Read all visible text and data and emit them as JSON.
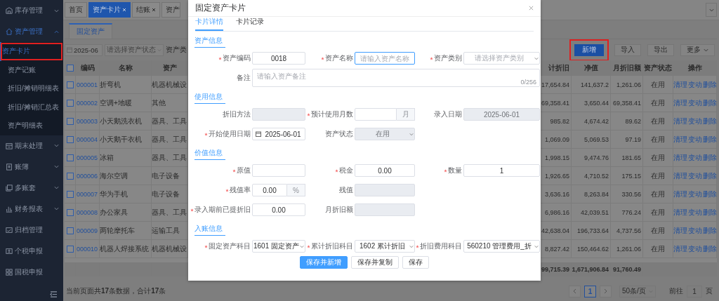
{
  "sidebar": {
    "items": [
      {
        "label": "库存管理",
        "kind": "group",
        "expanded": false,
        "active": false
      },
      {
        "label": "资产管理",
        "kind": "group",
        "expanded": true,
        "active": true,
        "children": [
          {
            "label": "资产卡片",
            "selected": true,
            "annotated": true
          },
          {
            "label": "资产记账",
            "selected": false,
            "annotated": false
          },
          {
            "label": "折旧/摊销明细表",
            "selected": false,
            "annotated": false
          },
          {
            "label": "折旧/摊销汇总表",
            "selected": false,
            "annotated": false
          },
          {
            "label": "资产明细表",
            "selected": false,
            "annotated": false
          }
        ]
      },
      {
        "label": "期末处理",
        "kind": "group",
        "expanded": false,
        "active": false
      },
      {
        "label": "账簿",
        "kind": "group",
        "expanded": false,
        "active": false
      },
      {
        "label": "多账套",
        "kind": "group",
        "expanded": false,
        "active": false
      },
      {
        "label": "财务报表",
        "kind": "group",
        "expanded": false,
        "active": false
      },
      {
        "label": "归档管理",
        "kind": "link",
        "active": false
      },
      {
        "label": "个税申报",
        "kind": "link",
        "active": false
      },
      {
        "label": "国税申报",
        "kind": "link",
        "active": false
      }
    ]
  },
  "page_tabs": [
    {
      "label": "首页",
      "closable": false,
      "selected": false
    },
    {
      "label": "资产卡片",
      "closable": true,
      "selected": true
    },
    {
      "label": "结账",
      "closable": true,
      "selected": false
    },
    {
      "label": "资产",
      "closable": false,
      "selected": false
    }
  ],
  "sub_tab": {
    "label": "固定资产"
  },
  "filters": {
    "period": "2025-06",
    "status_placeholder": "请选择资产状态",
    "category_label": "资产类"
  },
  "toolbar_buttons": [
    {
      "label": "新增",
      "kind": "primary",
      "annotated": true
    },
    {
      "label": "导入",
      "kind": "default",
      "annotated": false
    },
    {
      "label": "导出",
      "kind": "default",
      "annotated": false
    },
    {
      "label": "更多",
      "kind": "dropdown",
      "annotated": false
    }
  ],
  "table": {
    "select_all": false,
    "columns": {
      "code": "编码",
      "name": "名称",
      "column_4": "资产",
      "column_5": "计折旧",
      "net_value": "净值",
      "monthly_depreciation": "月折旧额",
      "status": "资产状态",
      "actions": "操作"
    },
    "rows": [
      {
        "selected": false,
        "code": "000001",
        "name": "折弯机",
        "column_4": "机器机械设",
        "column_5": "17,654.84",
        "net_value": "141,637.2",
        "monthly_depreciation": "1,261.06",
        "status": "在用",
        "actions": [
          "清理",
          "变动",
          "删除"
        ]
      },
      {
        "selected": false,
        "code": "000002",
        "name": "空调+地暖",
        "column_4": "其他",
        "column_5": "69,358.41",
        "net_value": "3,650.44",
        "monthly_depreciation": "69,358.41",
        "status": "在用",
        "actions": [
          "清理",
          "变动",
          "删除"
        ]
      },
      {
        "selected": false,
        "code": "000003",
        "name": "小天鹅洗衣机",
        "column_4": "器具、工具",
        "column_5": "985.82",
        "net_value": "4,674.42",
        "monthly_depreciation": "89.62",
        "status": "在用",
        "actions": [
          "清理",
          "变动",
          "删除"
        ]
      },
      {
        "selected": false,
        "code": "000004",
        "name": "小天鹅干衣机",
        "column_4": "器具、工具",
        "column_5": "1,069.09",
        "net_value": "5,069.53",
        "monthly_depreciation": "97.19",
        "status": "在用",
        "actions": [
          "清理",
          "变动",
          "删除"
        ]
      },
      {
        "selected": false,
        "code": "000005",
        "name": "冰箱",
        "column_4": "器具、工具",
        "column_5": "1,998.15",
        "net_value": "9,474.76",
        "monthly_depreciation": "181.65",
        "status": "在用",
        "actions": [
          "清理",
          "变动",
          "删除"
        ]
      },
      {
        "selected": false,
        "code": "000006",
        "name": "海尔空调",
        "column_4": "电子设备",
        "column_5": "1,926.65",
        "net_value": "4,710.52",
        "monthly_depreciation": "175.15",
        "status": "在用",
        "actions": [
          "清理",
          "变动",
          "删除"
        ]
      },
      {
        "selected": false,
        "code": "000007",
        "name": "华为手机",
        "column_4": "电子设备",
        "column_5": "3,636.16",
        "net_value": "8,263.84",
        "monthly_depreciation": "330.56",
        "status": "在用",
        "actions": [
          "清理",
          "变动",
          "删除"
        ]
      },
      {
        "selected": false,
        "code": "000008",
        "name": "办公家具",
        "column_4": "器具、工具",
        "column_5": "6,986.16",
        "net_value": "42,039.51",
        "monthly_depreciation": "776.24",
        "status": "在用",
        "actions": [
          "清理",
          "变动",
          "删除"
        ]
      },
      {
        "selected": false,
        "code": "000009",
        "name": "两轮摩托车",
        "column_4": "运输工具",
        "column_5": "42,638.04",
        "net_value": "196,733.64",
        "monthly_depreciation": "4,737.56",
        "status": "在用",
        "actions": [
          "清理",
          "变动",
          "删除"
        ]
      },
      {
        "selected": false,
        "code": "000010",
        "name": "机器人焊接系统",
        "column_4": "机器机械设",
        "column_5": "8,827.42",
        "net_value": "150,464.62",
        "monthly_depreciation": "1,261.06",
        "status": "在用",
        "actions": [
          "清理",
          "变动",
          "删除"
        ]
      }
    ],
    "totals": {
      "column_5": "99,715.39",
      "net_value": "1,671,906.84",
      "monthly_depreciation": "91,760.49"
    }
  },
  "footer": {
    "summary": "当前页面共**17**条数据，合计**17**条",
    "pages": [
      {
        "label": "1",
        "selected": true
      }
    ],
    "page_size": "50条/页",
    "goto_label": "前往",
    "goto_value": "1",
    "goto_unit": "页"
  },
  "modal": {
    "title": "固定资产卡片",
    "tabs": [
      {
        "label": "卡片详情",
        "selected": true
      },
      {
        "label": "卡片记录",
        "selected": false
      }
    ],
    "sections": [
      {
        "title": "资产信息",
        "rows": [
          [
            {
              "label": "资产编码",
              "required": true,
              "kind": "input",
              "value": "0018",
              "disabled": false,
              "focused": false
            },
            {
              "label": "资产名称",
              "required": true,
              "kind": "input",
              "placeholder": "请输入资产名称",
              "disabled": false,
              "focused": true
            },
            {
              "label": "资产类别",
              "required": true,
              "kind": "select",
              "placeholder": "请选择资产类别",
              "disabled": false,
              "focused": false
            }
          ],
          [
            {
              "label": "备注",
              "required": false,
              "kind": "textarea",
              "placeholder": "请输入资产备注",
              "counter": "0/256",
              "disabled": false,
              "focused": false
            }
          ]
        ]
      },
      {
        "title": "使用信息",
        "rows": [
          [
            {
              "label": "折旧方法",
              "required": false,
              "kind": "input",
              "disabled": true,
              "focused": false
            },
            {
              "label": "预计使用月数",
              "required": true,
              "kind": "addon",
              "suffix": "月",
              "disabled": false,
              "focused": false
            },
            {
              "label": "录入日期",
              "required": false,
              "kind": "input",
              "value": "2025-06-01",
              "disabled": true,
              "focused": false
            }
          ],
          [
            {
              "label": "开始使用日期",
              "required": true,
              "kind": "date",
              "value": "2025-06-01",
              "disabled": false,
              "focused": false
            },
            {
              "label": "资产状态",
              "required": false,
              "kind": "select",
              "value": "在用",
              "disabled": true,
              "focused": false
            }
          ]
        ]
      },
      {
        "title": "价值信息",
        "rows": [
          [
            {
              "label": "原值",
              "required": true,
              "kind": "input",
              "disabled": false,
              "focused": false
            },
            {
              "label": "税金",
              "required": true,
              "kind": "input",
              "value": "0.00",
              "disabled": false,
              "focused": false
            },
            {
              "label": "数量",
              "required": true,
              "kind": "input",
              "value": "1",
              "disabled": false,
              "focused": false
            }
          ],
          [
            {
              "label": "残值率",
              "required": true,
              "kind": "addon",
              "value": "0.00",
              "suffix": "%",
              "disabled": false,
              "focused": false
            },
            {
              "label": "残值",
              "required": false,
              "kind": "input",
              "disabled": true,
              "focused": false
            }
          ],
          [
            {
              "label": "录入期前已提折旧",
              "required": true,
              "kind": "input",
              "value": "0.00",
              "disabled": false,
              "focused": false
            },
            {
              "label": "月折旧额",
              "required": false,
              "kind": "input",
              "disabled": true,
              "focused": false
            }
          ]
        ]
      },
      {
        "title": "入账信息",
        "rows": [
          [
            {
              "label": "固定资产科目",
              "required": true,
              "kind": "select",
              "value": "1601 固定资产",
              "disabled": false,
              "focused": false
            },
            {
              "label": "累计折旧科目",
              "required": true,
              "kind": "select",
              "value": "1602 累计折旧",
              "disabled": false,
              "focused": false
            },
            {
              "label": "折旧费用科目",
              "required": true,
              "kind": "select",
              "value": "560210 管理费用_折",
              "disabled": false,
              "focused": false
            }
          ]
        ]
      }
    ],
    "buttons": [
      {
        "label": "保存并新增",
        "kind": "primary"
      },
      {
        "label": "保存并复制",
        "kind": "default"
      },
      {
        "label": "保存",
        "kind": "default"
      }
    ]
  }
}
